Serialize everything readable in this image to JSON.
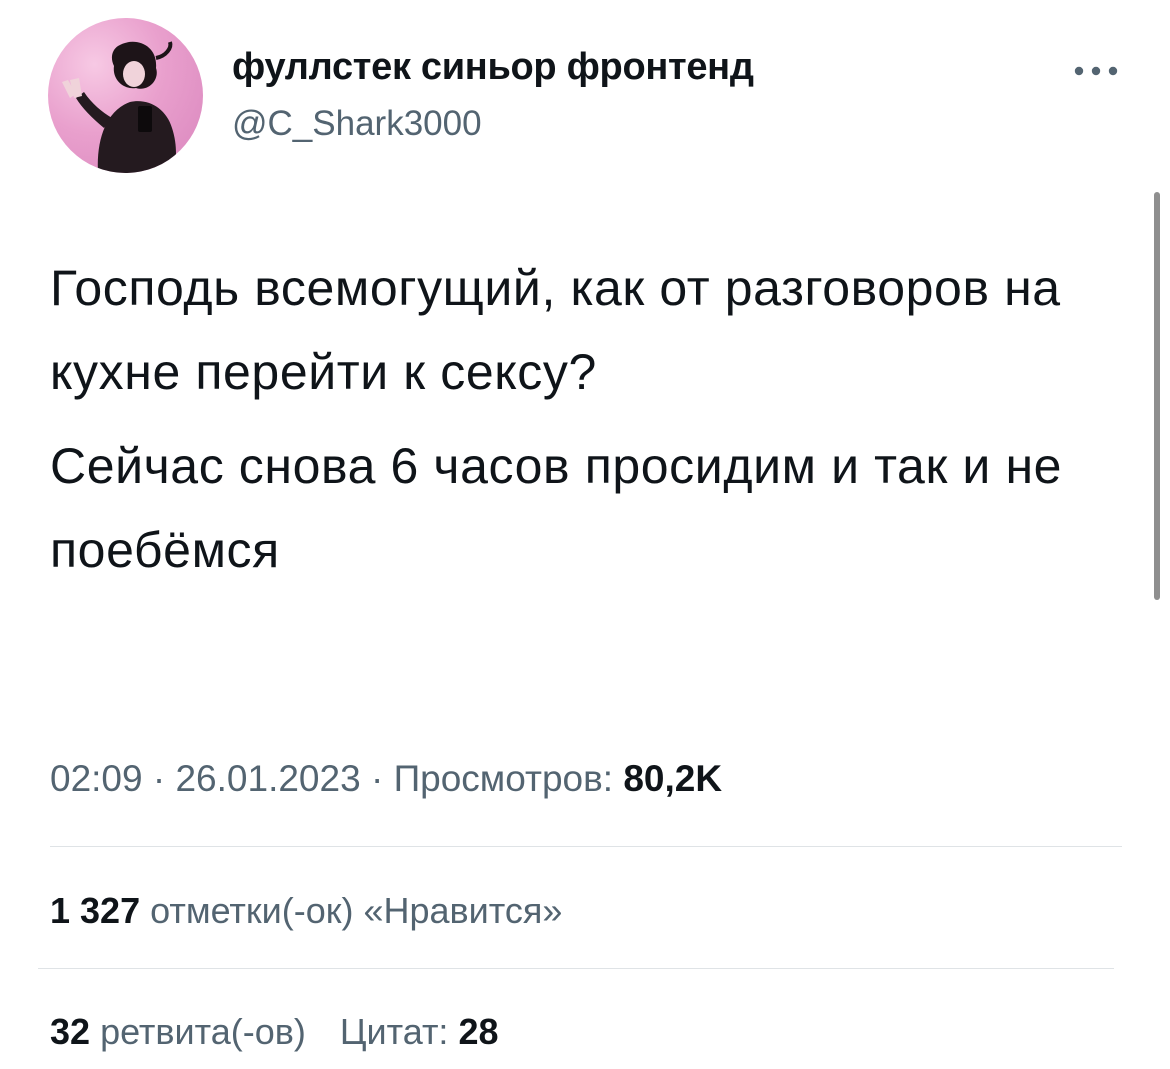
{
  "tweet": {
    "author": {
      "display_name": "фуллстек синьор фронтенд",
      "handle": "@C_Shark3000"
    },
    "text_paragraphs": [
      "Господь всемогущий, как от разговоров на кухне перейти к сексу?",
      "Сейчас снова 6 часов просидим и так и не поебёмся"
    ],
    "time": "02:09",
    "date": "26.01.2023",
    "views_label": "Просмотров:",
    "views_count": "80,2K",
    "likes_count": "1 327",
    "likes_label": "отметки(-ок) «Нравится»",
    "retweets_count": "32",
    "retweets_label": "ретвита(-ов)",
    "quotes_label": "Цитат:",
    "quotes_count": "28"
  },
  "icons": {
    "more": "more-horizontal-icon"
  },
  "colors": {
    "text_primary": "#0f1419",
    "text_secondary": "#536471",
    "divider": "#dfe3e6",
    "avatar_bg": "#e9a0cd"
  }
}
